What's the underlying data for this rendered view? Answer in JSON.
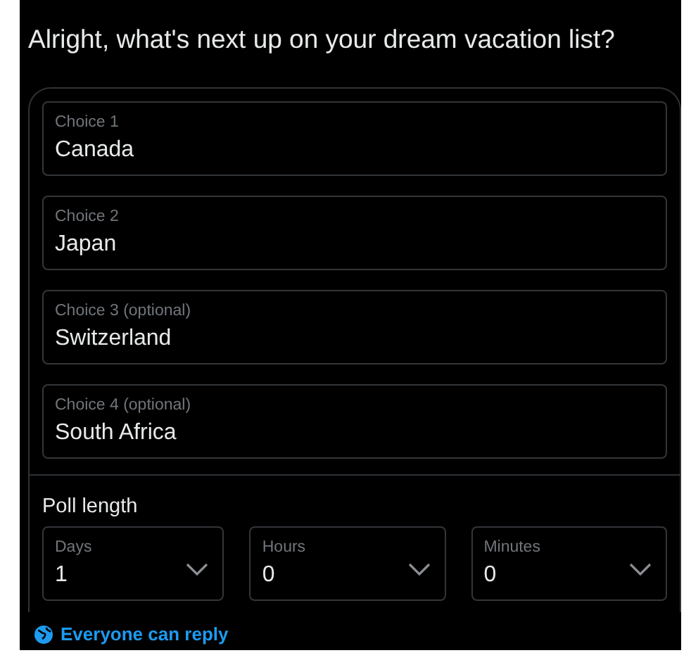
{
  "title": "Alright, what's next up on your dream vacation list?",
  "choices": [
    {
      "label": "Choice 1",
      "value": "Canada"
    },
    {
      "label": "Choice 2",
      "value": "Japan"
    },
    {
      "label": "Choice 3 (optional)",
      "value": "Switzerland"
    },
    {
      "label": "Choice 4 (optional)",
      "value": "South Africa"
    }
  ],
  "poll_length": {
    "label": "Poll length",
    "fields": [
      {
        "label": "Days",
        "value": "1"
      },
      {
        "label": "Hours",
        "value": "0"
      },
      {
        "label": "Minutes",
        "value": "0"
      }
    ]
  },
  "reply_setting": "Everyone can reply"
}
